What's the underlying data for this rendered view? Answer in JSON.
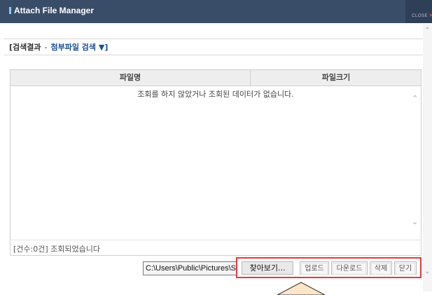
{
  "window": {
    "title": "Attach File Manager",
    "close_label": "CLOSE",
    "close_x": "×"
  },
  "breadcrumb": {
    "label": "[검색결과",
    "separator": "-",
    "link": "첨부파일 검색 ▼]"
  },
  "grid": {
    "columns": [
      "파일명",
      "파일크기"
    ],
    "empty_message": "조회를 하지 않았거나 조회된 데이터가 없습니다.",
    "count_text": "[건수:0건] 조회되었습니다"
  },
  "file_path": {
    "value": "C:\\Users\\Public\\Pictures\\S"
  },
  "buttons": {
    "browse": "찾아보기...",
    "upload": "업로드",
    "download": "다운로드",
    "delete": "삭제",
    "close": "닫기"
  },
  "icons": {
    "scroll_up": "chevron-up-icon",
    "scroll_down": "chevron-down-icon"
  },
  "colors": {
    "titlebar": "#3a4d68",
    "highlight": "#e23a3a",
    "link": "#1a4f96",
    "callout": "#fde6c8"
  }
}
